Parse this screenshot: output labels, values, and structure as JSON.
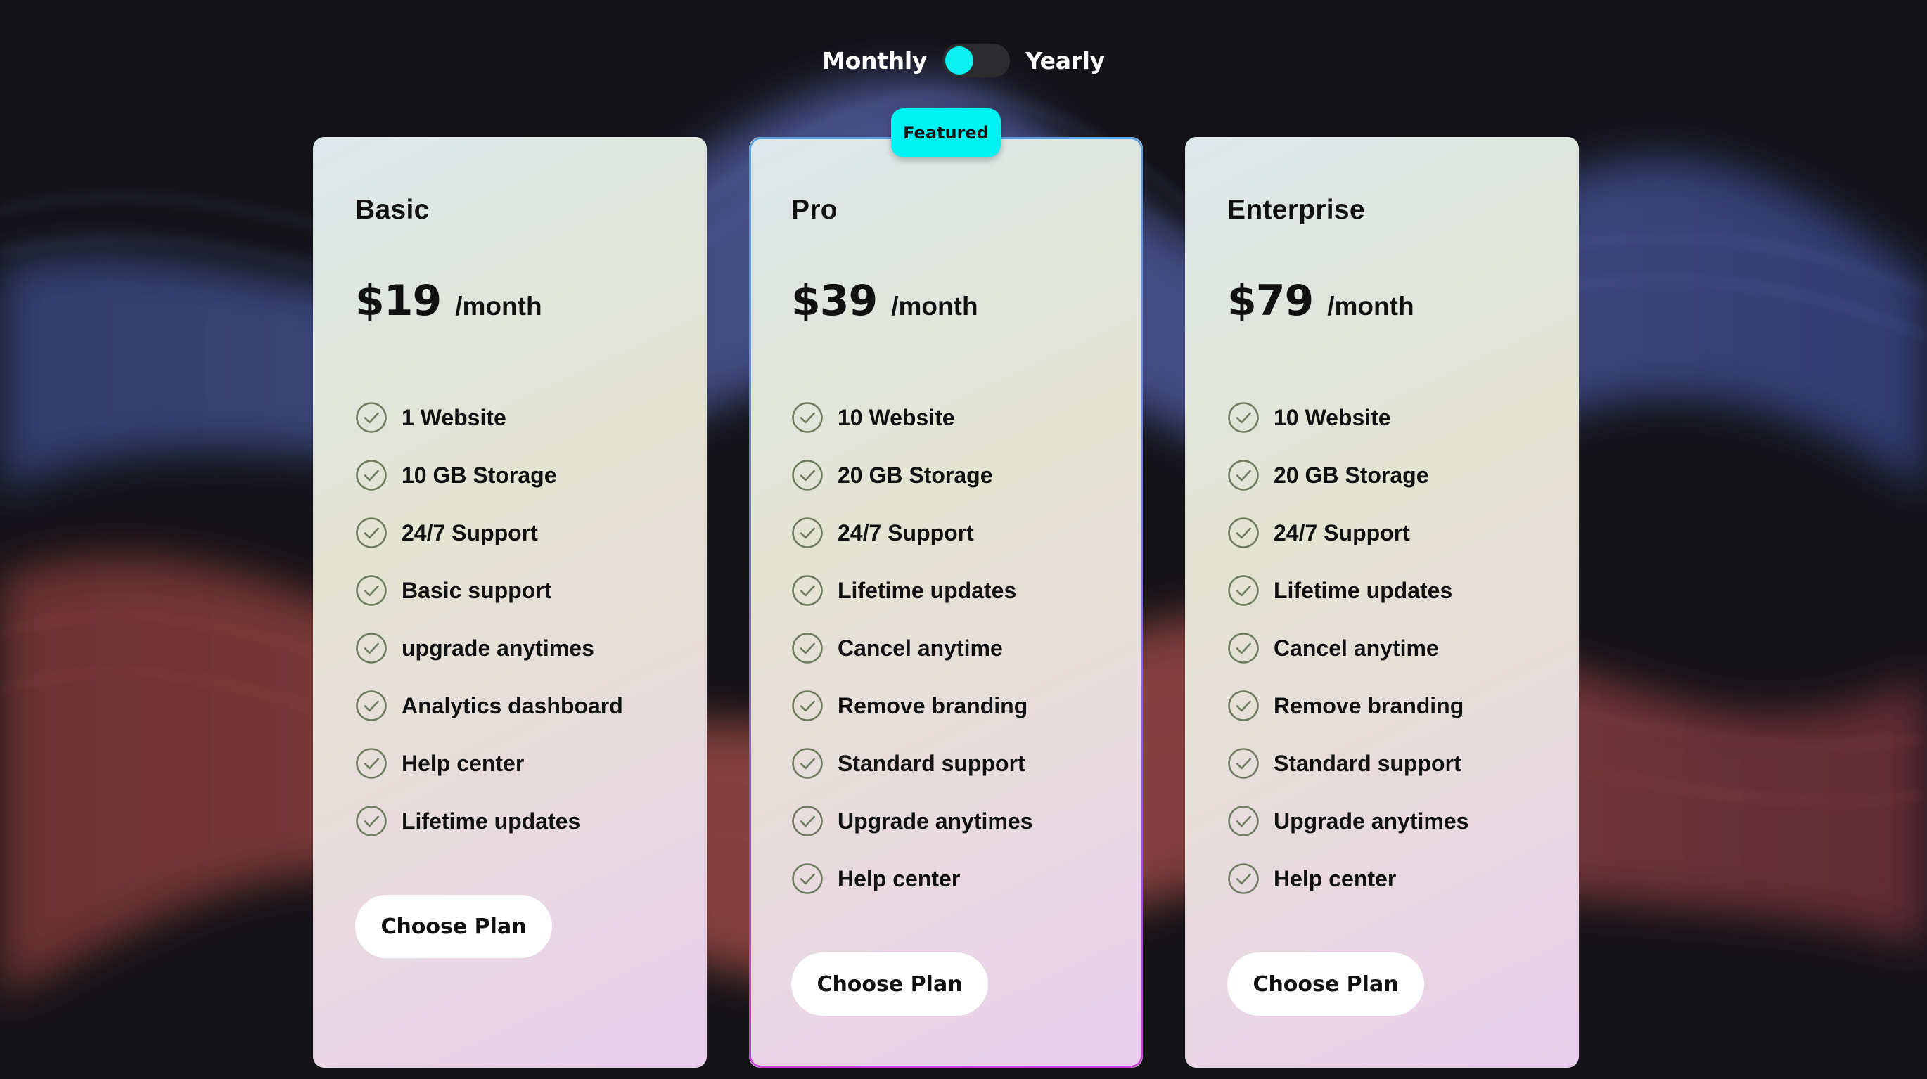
{
  "toggle": {
    "monthly_label": "Monthly",
    "yearly_label": "Yearly",
    "selected": "Monthly",
    "knob_color": "#0af0f0"
  },
  "colors": {
    "accent": "#00f2f2",
    "background": "#15141a",
    "card_text": "#111111",
    "check": "#6e7a5e"
  },
  "plans": [
    {
      "name": "Basic",
      "price": "$19",
      "period": "/month",
      "featured": false,
      "features": [
        "1 Website",
        "10 GB Storage",
        "24/7 Support",
        "Basic support",
        "upgrade anytimes",
        "Analytics dashboard",
        "Help center",
        "Lifetime updates"
      ],
      "button_label": "Choose Plan"
    },
    {
      "name": "Pro",
      "price": "$39",
      "period": "/month",
      "featured": true,
      "badge": "Featured",
      "features": [
        "10 Website",
        "20 GB Storage",
        "24/7 Support",
        "Lifetime updates",
        "Cancel anytime",
        "Remove branding",
        "Standard support",
        "Upgrade anytimes",
        "Help center"
      ],
      "button_label": "Choose Plan"
    },
    {
      "name": "Enterprise",
      "price": "$79",
      "period": "/month",
      "featured": false,
      "features": [
        "10 Website",
        "20 GB Storage",
        "24/7 Support",
        "Lifetime updates",
        "Cancel anytime",
        "Remove branding",
        "Standard support",
        "Upgrade anytimes",
        "Help center"
      ],
      "button_label": "Choose Plan"
    }
  ]
}
